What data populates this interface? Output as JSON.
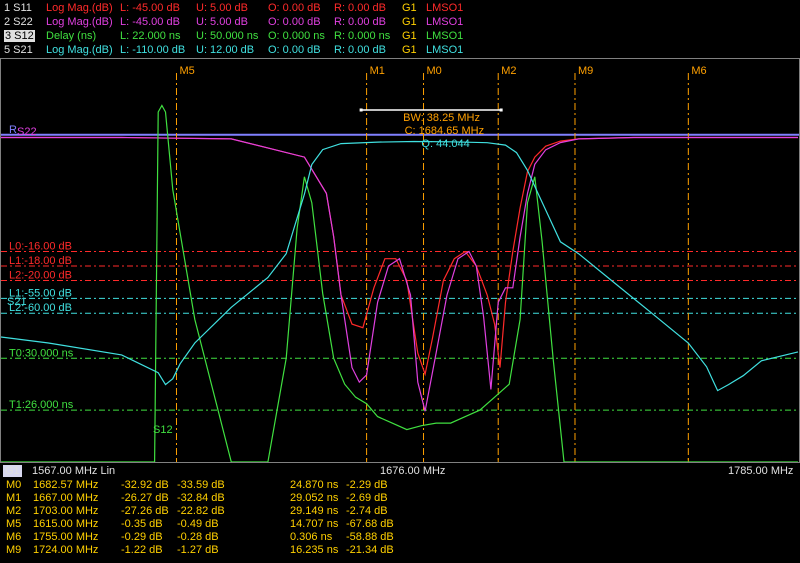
{
  "colors": {
    "s11": "#ff2a2a",
    "s22": "#e040e0",
    "s12": "#40e040",
    "s21": "#40e0e0",
    "marker": "#ffa000",
    "axis": "#e0e0e0"
  },
  "traces": [
    {
      "id": "1 S11",
      "format": "Log Mag.(dB)",
      "l": "L: -45.00 dB",
      "u": "U: 5.00 dB",
      "o": "O: 0.00 dB",
      "r": "R: 0.00 dB",
      "g": "G1",
      "cal": "LMSO1",
      "color": "#ff2a2a"
    },
    {
      "id": "2 S22",
      "format": "Log Mag.(dB)",
      "l": "L: -45.00 dB",
      "u": "U: 5.00 dB",
      "o": "O: 0.00 dB",
      "r": "R: 0.00 dB",
      "g": "G1",
      "cal": "LMSO1",
      "color": "#e040e0"
    },
    {
      "id": "3 S12",
      "format": "Delay (ns)",
      "l": "L: 22.000 ns",
      "u": "U: 50.000 ns",
      "o": "O: 0.000 ns",
      "r": "R: 0.000 ns",
      "g": "G1",
      "cal": "LMSO1",
      "color": "#40e040"
    },
    {
      "id": "5 S21",
      "format": "Log Mag.(dB)",
      "l": "L: -110.00 dB",
      "u": "U: 12.00 dB",
      "o": "O: 0.00 dB",
      "r": "R: 0.00 dB",
      "g": "G1",
      "cal": "LMSO1",
      "color": "#40e0e0"
    }
  ],
  "axis": {
    "group": "G1",
    "start": "1567.00 MHz Lin",
    "center": "1676.00 MHz",
    "stop": "1785.00 MHz"
  },
  "markers_table": [
    {
      "name": "M0",
      "freq": "1682.57 MHz",
      "v1": "-32.92 dB",
      "v2": "-33.59 dB",
      "v3": "24.870 ns",
      "v4": "-2.29 dB"
    },
    {
      "name": "M1",
      "freq": "1667.00 MHz",
      "v1": "-26.27 dB",
      "v2": "-32.84 dB",
      "v3": "29.052 ns",
      "v4": "-2.69 dB"
    },
    {
      "name": "M2",
      "freq": "1703.00 MHz",
      "v1": "-27.26 dB",
      "v2": "-22.82 dB",
      "v3": "29.149 ns",
      "v4": "-2.74 dB"
    },
    {
      "name": "M5",
      "freq": "1615.00 MHz",
      "v1": "-0.35 dB",
      "v2": "-0.49 dB",
      "v3": "14.707 ns",
      "v4": "-67.68 dB"
    },
    {
      "name": "M6",
      "freq": "1755.00 MHz",
      "v1": "-0.29 dB",
      "v2": "-0.28 dB",
      "v3": "0.306 ns",
      "v4": "-58.88 dB"
    },
    {
      "name": "M9",
      "freq": "1724.00 MHz",
      "v1": "-1.22 dB",
      "v2": "-1.27 dB",
      "v3": "16.235 ns",
      "v4": "-21.34 dB"
    }
  ],
  "chart_data": {
    "type": "line",
    "x_unit": "MHz",
    "xlim": [
      1567,
      1785
    ],
    "top_markers": [
      {
        "name": "M5",
        "x": 1615
      },
      {
        "name": "M1",
        "x": 1667
      },
      {
        "name": "M0",
        "x": 1682.57
      },
      {
        "name": "M2",
        "x": 1703
      },
      {
        "name": "M9",
        "x": 1724
      },
      {
        "name": "M6",
        "x": 1755
      }
    ],
    "bw_annotation": {
      "bw": "BW: 38.25 MHz",
      "c": "C: 1684.65 MHz",
      "q": "Q: 44.044"
    },
    "ref_labels": {
      "r": "R",
      "s22": "S22",
      "s21": "S21",
      "s12": "S12"
    },
    "limit_lines": [
      {
        "label": "L0:-16.00 dB",
        "color": "#ff2a2a",
        "value": -16,
        "scale": "s11"
      },
      {
        "label": "L1:-18.00 dB",
        "color": "#ff2a2a",
        "value": -18,
        "scale": "s11"
      },
      {
        "label": "L2:-20.00 dB",
        "color": "#ff2a2a",
        "value": -20,
        "scale": "s11"
      },
      {
        "label": "L1:-55.00 dB",
        "color": "#40e0e0",
        "value": -55,
        "scale": "s21"
      },
      {
        "label": "L2:-60.00 dB",
        "color": "#40e0e0",
        "value": -60,
        "scale": "s21"
      },
      {
        "label": "T0:30.000 ns",
        "color": "#40e040",
        "value": 30,
        "scale": "s12"
      },
      {
        "label": "T1:26.000 ns",
        "color": "#40e040",
        "value": 26,
        "scale": "s12"
      }
    ],
    "scales": {
      "s11": [
        -45,
        5
      ],
      "s22": [
        -45,
        5
      ],
      "s12": [
        22,
        50
      ],
      "s21": [
        -110,
        12
      ]
    },
    "series": [
      {
        "name": "S11",
        "scale": "s11",
        "color": "#ff2a2a",
        "x": [
          1567,
          1600,
          1630,
          1650,
          1656,
          1658,
          1660,
          1663,
          1666,
          1669,
          1672,
          1675,
          1678,
          1681,
          1683,
          1685,
          1688,
          1691,
          1694,
          1697,
          1700,
          1702,
          1703.5,
          1705,
          1707,
          1709,
          1711,
          1713,
          1716,
          1720,
          1725,
          1740,
          1785
        ],
        "y": [
          -0.3,
          -0.3,
          -0.5,
          -3,
          -8,
          -14,
          -22,
          -26,
          -26.5,
          -21,
          -17,
          -17,
          -20,
          -30,
          -32.9,
          -28,
          -20,
          -17,
          -16,
          -18,
          -22,
          -26,
          -32,
          -23,
          -16,
          -10,
          -5,
          -3,
          -1.5,
          -0.8,
          -0.5,
          -0.3,
          -0.3
        ]
      },
      {
        "name": "S22",
        "scale": "s22",
        "color": "#e040e0",
        "x": [
          1567,
          1600,
          1630,
          1650,
          1656,
          1658,
          1660,
          1663,
          1665,
          1667,
          1670,
          1673,
          1676,
          1679,
          1681,
          1683,
          1686,
          1689,
          1692,
          1695,
          1697,
          1699,
          1701,
          1703,
          1705,
          1707,
          1709,
          1711,
          1713,
          1716,
          1720,
          1725,
          1740,
          1785
        ],
        "y": [
          -0.3,
          -0.3,
          -0.5,
          -3,
          -8,
          -14,
          -22,
          -32,
          -34,
          -33,
          -23,
          -18,
          -17,
          -22,
          -34,
          -38,
          -30,
          -22,
          -17,
          -16,
          -18,
          -25,
          -35,
          -23,
          -21,
          -21,
          -14,
          -8,
          -4,
          -2,
          -1,
          -0.5,
          -0.3,
          -0.3
        ]
      },
      {
        "name": "S12",
        "scale": "s12",
        "color": "#40e040",
        "x": [
          1567,
          1600,
          1609,
          1610,
          1611,
          1612,
          1614,
          1620,
          1630,
          1640,
          1645,
          1648,
          1650,
          1652,
          1655,
          1658,
          1661,
          1664,
          1667,
          1670,
          1674,
          1678,
          1682,
          1686,
          1690,
          1694,
          1698,
          1702,
          1706,
          1709,
          1711,
          1713,
          1715,
          1718,
          1721,
          1725,
          1730,
          1785
        ],
        "y": [
          22,
          22,
          22,
          49,
          49.5,
          49,
          43,
          33,
          22,
          22,
          30,
          40,
          44,
          42,
          35,
          30,
          28,
          27,
          26.5,
          25.5,
          25,
          24.5,
          24.8,
          25,
          25,
          25.5,
          26,
          27,
          28,
          33,
          42,
          44,
          39,
          30,
          22,
          22,
          22,
          22
        ]
      },
      {
        "name": "S21",
        "scale": "s21",
        "color": "#40e0e0",
        "x": [
          1567,
          1580,
          1600,
          1610,
          1612,
          1614,
          1616,
          1620,
          1630,
          1640,
          1645,
          1650,
          1652,
          1655,
          1660,
          1670,
          1680,
          1690,
          1700,
          1705,
          1708,
          1711,
          1714,
          1717,
          1720,
          1725,
          1735,
          1745,
          1755,
          1760,
          1763,
          1766,
          1770,
          1775,
          1785
        ],
        "y": [
          -68,
          -70,
          -74,
          -80,
          -84,
          -82,
          -77,
          -70,
          -58,
          -48,
          -40,
          -20,
          -10,
          -5,
          -3,
          -2.5,
          -2.3,
          -2.4,
          -2.7,
          -3.5,
          -6,
          -12,
          -20,
          -28,
          -36,
          -40,
          -50,
          -60,
          -70,
          -78,
          -86,
          -84,
          -81,
          -76,
          -73
        ]
      }
    ]
  }
}
